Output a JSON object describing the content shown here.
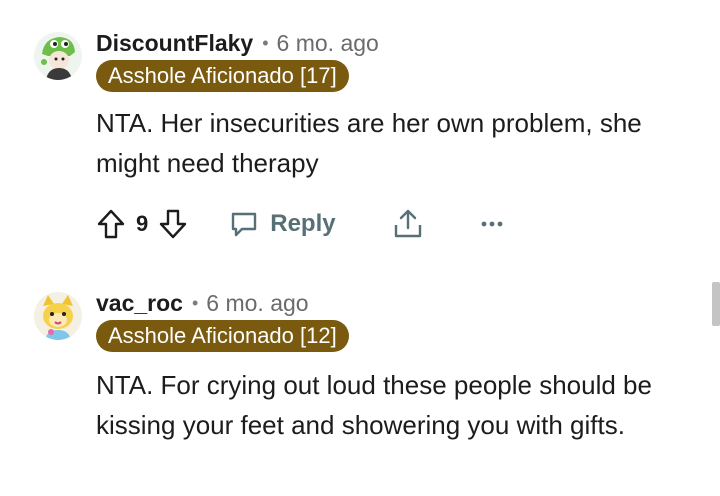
{
  "comments": [
    {
      "username": "DiscountFlaky",
      "time": "6 mo. ago",
      "flair": "Asshole Aficionado [17]",
      "body": "NTA. Her insecurities are her own problem, she might need therapy",
      "votes": "9",
      "reply_label": "Reply"
    },
    {
      "username": "vac_roc",
      "time": "6 mo. ago",
      "flair": "Asshole Aficionado [12]",
      "body": "NTA. For crying out loud these people should be kissing your feet and showering you with gifts."
    }
  ],
  "separator": "•",
  "colors": {
    "flair_bg": "#7a5a0f",
    "action_gray": "#576f76"
  },
  "icons": [
    "upvote-icon",
    "downvote-icon",
    "reply-icon",
    "share-icon",
    "more-icon"
  ]
}
